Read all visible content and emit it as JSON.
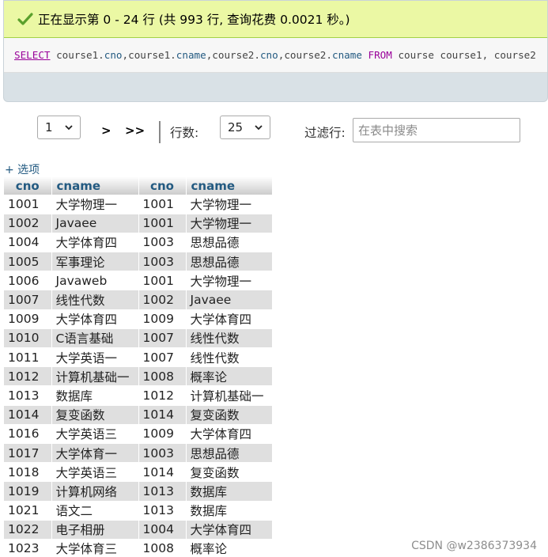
{
  "message": {
    "status_text": "正在显示第 0 - 24 行 (共 993 行, 查询花费 0.0021 秒。)",
    "check_icon": "check-icon"
  },
  "sql": {
    "select_kw": "SELECT",
    "columns": [
      "course1.",
      "cno",
      ",",
      "course1.",
      "cname",
      ",",
      "course2.",
      "cno",
      ",",
      "course2.",
      "cname"
    ],
    "from_kw": "FROM",
    "tail": "course course1, course2"
  },
  "navigation": {
    "page_value": "1",
    "next_label": ">",
    "last_label": ">>",
    "rows_label": "行数:",
    "rows_value": "25",
    "filter_label": "过滤行:",
    "filter_placeholder": "在表中搜索"
  },
  "options_label": "+ 选项",
  "table": {
    "headers": [
      "cno",
      "cname",
      "cno",
      "cname"
    ],
    "rows": [
      [
        "1001",
        "大学物理一",
        "1001",
        "大学物理一"
      ],
      [
        "1002",
        "Javaee",
        "1001",
        "大学物理一"
      ],
      [
        "1004",
        "大学体育四",
        "1003",
        "思想品德"
      ],
      [
        "1005",
        "军事理论",
        "1003",
        "思想品德"
      ],
      [
        "1006",
        "Javaweb",
        "1001",
        "大学物理一"
      ],
      [
        "1007",
        "线性代数",
        "1002",
        "Javaee"
      ],
      [
        "1009",
        "大学体育四",
        "1009",
        "大学体育四"
      ],
      [
        "1010",
        "C语言基础",
        "1007",
        "线性代数"
      ],
      [
        "1011",
        "大学英语一",
        "1007",
        "线性代数"
      ],
      [
        "1012",
        "计算机基础一",
        "1008",
        "概率论"
      ],
      [
        "1013",
        "数据库",
        "1012",
        "计算机基础一"
      ],
      [
        "1014",
        "复变函数",
        "1014",
        "复变函数"
      ],
      [
        "1016",
        "大学英语三",
        "1009",
        "大学体育四"
      ],
      [
        "1017",
        "大学体育一",
        "1003",
        "思想品德"
      ],
      [
        "1018",
        "大学英语三",
        "1014",
        "复变函数"
      ],
      [
        "1019",
        "计算机网络",
        "1013",
        "数据库"
      ],
      [
        "1021",
        "语文二",
        "1013",
        "数据库"
      ],
      [
        "1022",
        "电子相册",
        "1004",
        "大学体育四"
      ],
      [
        "1023",
        "大学体育三",
        "1008",
        "概率论"
      ]
    ]
  },
  "watermark": "CSDN @w2386373934",
  "colors": {
    "success_bg": "#ebf8a4",
    "keyword": "#990099",
    "column": "#235a81",
    "row_alt": "#dfdfdf"
  }
}
